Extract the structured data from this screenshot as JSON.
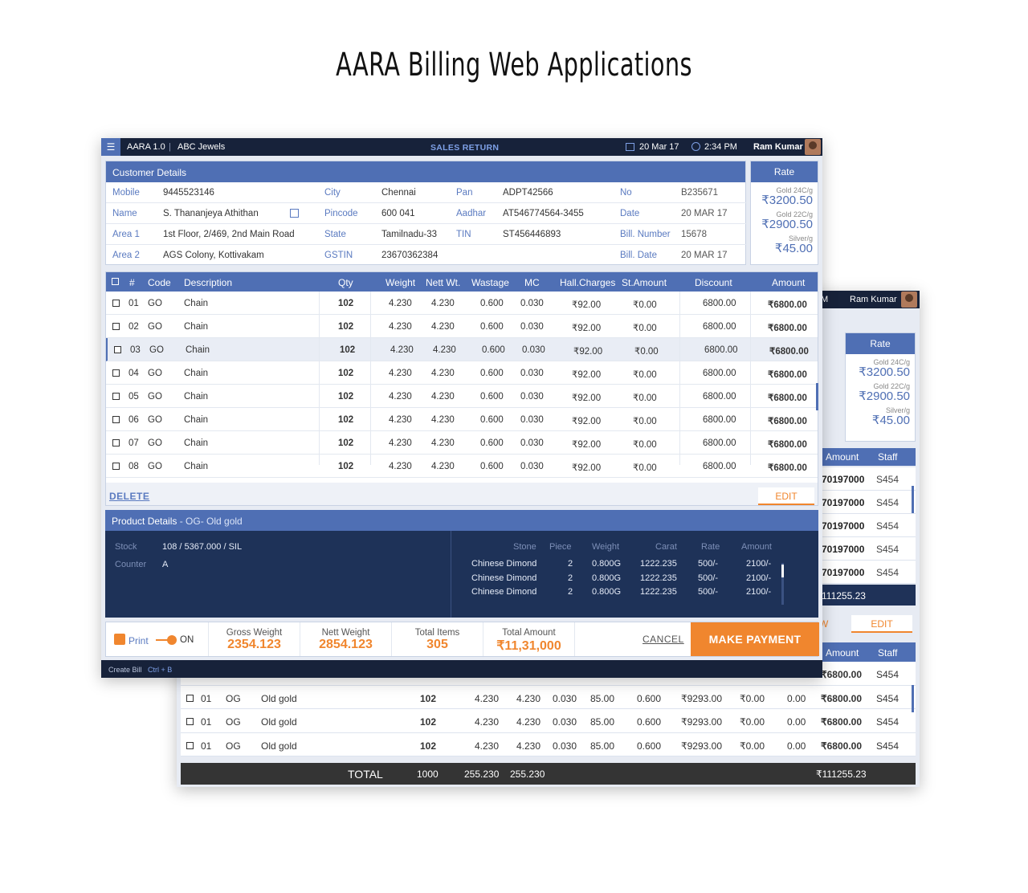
{
  "page_title": "AARA Billing Web Applications",
  "front": {
    "topbar": {
      "app": "AARA 1.0",
      "company": "ABC Jewels",
      "screen": "SALES RETURN",
      "date": "20 Mar 17",
      "time": "2:34 PM",
      "user": "Ram Kumar"
    },
    "customer": {
      "header": "Customer Details",
      "mobile_label": "Mobile",
      "mobile": "9445523146",
      "name_label": "Name",
      "name": "S. Thananjeya Athithan",
      "area1_label": "Area 1",
      "area1": "1st Floor, 2/469, 2nd Main Road",
      "area2_label": "Area 2",
      "area2": "AGS Colony, Kottivakam",
      "city_label": "City",
      "city": "Chennai",
      "pincode_label": "Pincode",
      "pincode": "600 041",
      "state_label": "State",
      "state": "Tamilnadu-33",
      "gstin_label": "GSTIN",
      "gstin": "23670362384",
      "pan_label": "Pan",
      "pan": "ADPT42566",
      "aadhar_label": "Aadhar",
      "aadhar": "AT546774564-3455",
      "tin_label": "TIN",
      "tin": "ST456446893",
      "no_label": "No",
      "no": "B235671",
      "date_label": "Date",
      "date": "20 MAR 17",
      "billnum_label": "Bill. Number",
      "billnum": "15678",
      "billdate_label": "Bill. Date",
      "billdate": "20 MAR 17"
    },
    "rate": {
      "header": "Rate",
      "gold24_label": "Gold 24C/g",
      "gold24": "₹3200.50",
      "gold22_label": "Gold 22C/g",
      "gold22": "₹2900.50",
      "silver_label": "Silver/g",
      "silver": "₹45.00"
    },
    "items": {
      "columns": [
        "#",
        "Code",
        "Description",
        "Qty",
        "Weight",
        "Nett Wt.",
        "Wastage",
        "MC",
        "Hall.Charges",
        "St.Amount",
        "Discount",
        "Amount"
      ],
      "rows": [
        [
          "01",
          "GO",
          "Chain",
          "102",
          "4.230",
          "4.230",
          "0.600",
          "0.030",
          "₹92.00",
          "₹0.00",
          "6800.00",
          "₹6800.00"
        ],
        [
          "02",
          "GO",
          "Chain",
          "102",
          "4.230",
          "4.230",
          "0.600",
          "0.030",
          "₹92.00",
          "₹0.00",
          "6800.00",
          "₹6800.00"
        ],
        [
          "03",
          "GO",
          "Chain",
          "102",
          "4.230",
          "4.230",
          "0.600",
          "0.030",
          "₹92.00",
          "₹0.00",
          "6800.00",
          "₹6800.00"
        ],
        [
          "04",
          "GO",
          "Chain",
          "102",
          "4.230",
          "4.230",
          "0.600",
          "0.030",
          "₹92.00",
          "₹0.00",
          "6800.00",
          "₹6800.00"
        ],
        [
          "05",
          "GO",
          "Chain",
          "102",
          "4.230",
          "4.230",
          "0.600",
          "0.030",
          "₹92.00",
          "₹0.00",
          "6800.00",
          "₹6800.00"
        ],
        [
          "06",
          "GO",
          "Chain",
          "102",
          "4.230",
          "4.230",
          "0.600",
          "0.030",
          "₹92.00",
          "₹0.00",
          "6800.00",
          "₹6800.00"
        ],
        [
          "07",
          "GO",
          "Chain",
          "102",
          "4.230",
          "4.230",
          "0.600",
          "0.030",
          "₹92.00",
          "₹0.00",
          "6800.00",
          "₹6800.00"
        ],
        [
          "08",
          "GO",
          "Chain",
          "102",
          "4.230",
          "4.230",
          "0.600",
          "0.030",
          "₹92.00",
          "₹0.00",
          "6800.00",
          "₹6800.00"
        ]
      ],
      "delete_label": "DELETE",
      "edit_label": "EDIT"
    },
    "product": {
      "header": "Product Details",
      "header_sub": " - OG- Old gold",
      "stock_label": "Stock",
      "stock": "108  /  5367.000  /  SIL",
      "counter_label": "Counter",
      "counter": "A",
      "stone_columns": [
        "Stone",
        "Piece",
        "Weight",
        "Carat",
        "Rate",
        "Amount"
      ],
      "stones": [
        [
          "Chinese Dimond",
          "2",
          "0.800G",
          "1222.235",
          "500/-",
          "2100/-"
        ],
        [
          "Chinese Dimond",
          "2",
          "0.800G",
          "1222.235",
          "500/-",
          "2100/-"
        ],
        [
          "Chinese Dimond",
          "2",
          "0.800G",
          "1222.235",
          "500/-",
          "2100/-"
        ]
      ]
    },
    "summary": {
      "print_label": "Print",
      "toggle_label": "ON",
      "gross_label": "Gross Weight",
      "gross": "2354.123",
      "nett_label": "Nett Weight",
      "nett": "2854.123",
      "items_label": "Total Items",
      "items": "305",
      "amount_label": "Total Amount",
      "amount": "₹11,31,000",
      "cancel_label": "CANCEL",
      "pay_label": "MAKE PAYMENT"
    },
    "status": {
      "create": "Create Bill",
      "shortcut": "Ctrl + B"
    }
  },
  "back": {
    "topbar": {
      "partial": "M",
      "user": "Ram Kumar"
    },
    "rate": {
      "header": "Rate",
      "gold24_label": "Gold 24C/g",
      "gold24": "₹3200.50",
      "gold22_label": "Gold 22C/g",
      "gold22": "₹2900.50",
      "silver_label": "Silver/g",
      "silver": "₹45.00"
    },
    "side_head": {
      "amount": "Amount",
      "staff": "Staff"
    },
    "side_rows": [
      [
        "70197000",
        "S454"
      ],
      [
        "70197000",
        "S454"
      ],
      [
        "70197000",
        "S454"
      ],
      [
        "70197000",
        "S454"
      ],
      [
        "70197000",
        "S454"
      ]
    ],
    "side_total": "111255.23",
    "w_label": "W",
    "edit_label": "EDIT",
    "head2": {
      "amount": "Amount",
      "staff": "Staff"
    },
    "rows": [
      [
        "",
        "",
        "",
        "",
        "",
        "",
        "",
        "",
        "",
        "",
        "",
        "₹6800.00",
        "S454"
      ],
      [
        "01",
        "OG",
        "Old gold",
        "102",
        "4.230",
        "4.230",
        "0.030",
        "85.00",
        "0.600",
        "₹9293.00",
        "₹0.00",
        "0.00",
        "₹6800.00",
        "S454"
      ],
      [
        "01",
        "OG",
        "Old gold",
        "102",
        "4.230",
        "4.230",
        "0.030",
        "85.00",
        "0.600",
        "₹9293.00",
        "₹0.00",
        "0.00",
        "₹6800.00",
        "S454"
      ],
      [
        "01",
        "OG",
        "Old gold",
        "102",
        "4.230",
        "4.230",
        "0.030",
        "85.00",
        "0.600",
        "₹9293.00",
        "₹0.00",
        "0.00",
        "₹6800.00",
        "S454"
      ]
    ],
    "total": {
      "label": "TOTAL",
      "qty": "1000",
      "weight": "255.230",
      "nett": "255.230",
      "amount": "₹111255.23"
    }
  },
  "colors": {
    "primary": "#4f6fb4",
    "dark": "#17223a",
    "panel": "#1e3258",
    "accent": "#f0862e"
  }
}
